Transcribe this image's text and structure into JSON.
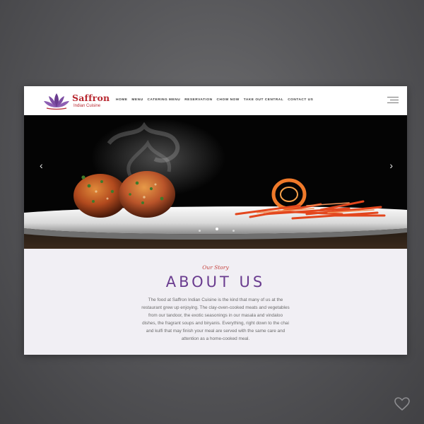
{
  "brand": {
    "name": "Saffron",
    "subtitle": "Indian Cuisine",
    "color": "#b8272f",
    "logo_icon": "lotus-icon"
  },
  "nav": {
    "items": [
      {
        "label": "HOME"
      },
      {
        "label": "MENU"
      },
      {
        "label": "CATERING MENU"
      },
      {
        "label": "RESERVATION"
      },
      {
        "label": "CHOW NOW"
      },
      {
        "label": "TAKE OUT CENTRAL"
      },
      {
        "label": "CONTACT US"
      }
    ],
    "menu_icon": "hamburger-icon"
  },
  "hero": {
    "prev_icon": "chevron-left-icon",
    "next_icon": "chevron-right-icon",
    "prev_glyph": "‹",
    "next_glyph": "›",
    "slide_count": 3,
    "active_slide": 2
  },
  "about": {
    "eyebrow": "Our Story",
    "title": "ABOUT US",
    "body": "The food at Saffron Indian Cuisine is the kind that many of us at the restaurant grew up enjoying. The clay-oven-cooked meats and vegetables from our tandoor, the exotic seasonings in our masala and vindaloo dishes, the fragrant soups and biryanis. Everything, right down to the chai and kulfi that may finish your meal are served with the same care and attention as a home-cooked meal.",
    "title_color": "#6a3c8f",
    "eyebrow_color": "#c5403c"
  },
  "overlay": {
    "favorite_icon": "heart-icon"
  }
}
